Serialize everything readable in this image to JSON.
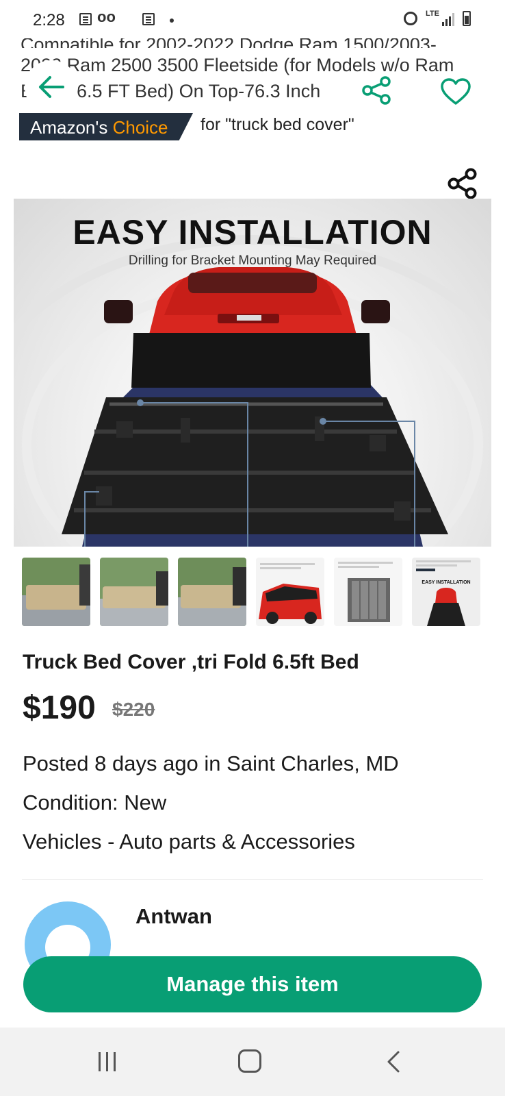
{
  "status_bar": {
    "time": "2:28",
    "network": "LTE"
  },
  "listing_image_text": {
    "line1": "Compatible for 2002-2022 Dodge Ram 1500/2003-",
    "line2": "2022 Ram 2500 3500 Fleetside (for Models w/o Ram",
    "line3_prefix": "B",
    "line3": "6.5 FT Bed) On Top-76.3 Inch"
  },
  "amazon_badge": {
    "brand": "Amazon's",
    "choice": "Choice",
    "query": "for \"truck bed cover\""
  },
  "hero": {
    "headline": "EASY INSTALLATION",
    "subheadline": "Drilling for Bracket Mounting May Required"
  },
  "thumbnails": {
    "count": 6,
    "selected_index": 5,
    "thumb6_caption": "EASY INSTALLATION"
  },
  "listing": {
    "title": "Truck  Bed Cover ,tri Fold 6.5ft Bed",
    "price": "$190",
    "original_price": "$220",
    "posted": "Posted 8 days ago in Saint Charles, MD",
    "condition": "Condition: New",
    "category": "Vehicles - Auto parts & Accessories"
  },
  "seller": {
    "name": "Antwan"
  },
  "actions": {
    "manage_label": "Manage this item"
  },
  "colors": {
    "accent_green": "#089e74",
    "amazon_dark": "#232f3e",
    "amazon_orange": "#ff9900",
    "avatar_blue": "#7cc7f5"
  },
  "icons": [
    "back-arrow-icon",
    "share-icon",
    "heart-icon",
    "recent-apps-icon",
    "home-icon",
    "back-nav-icon"
  ]
}
